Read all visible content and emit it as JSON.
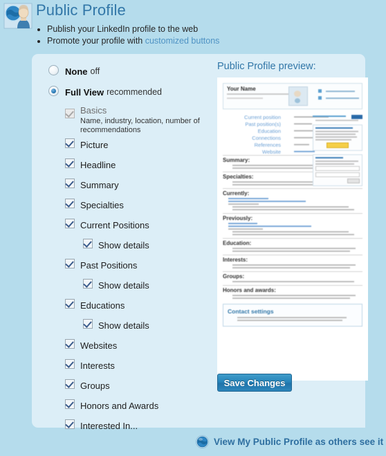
{
  "header": {
    "icon": "public-profile-avatar-icon",
    "title": "Public Profile",
    "bullets": [
      {
        "text_before": "Publish your LinkedIn profile to the web",
        "link": "",
        "text_after": ""
      },
      {
        "text_before": "Promote your profile with ",
        "link": "customized buttons",
        "text_after": ""
      }
    ]
  },
  "visibility": {
    "options": [
      {
        "label": "None",
        "sublabel": "off",
        "selected": false
      },
      {
        "label": "Full View",
        "sublabel": "recommended",
        "selected": true
      }
    ]
  },
  "sections": [
    {
      "label": "Basics",
      "checked": true,
      "disabled": true,
      "description": "Name, industry, location, number of recommendations",
      "sub": false
    },
    {
      "label": "Picture",
      "checked": true,
      "disabled": false,
      "description": "",
      "sub": false
    },
    {
      "label": "Headline",
      "checked": true,
      "disabled": false,
      "description": "",
      "sub": false
    },
    {
      "label": "Summary",
      "checked": true,
      "disabled": false,
      "description": "",
      "sub": false
    },
    {
      "label": "Specialties",
      "checked": true,
      "disabled": false,
      "description": "",
      "sub": false
    },
    {
      "label": "Current Positions",
      "checked": true,
      "disabled": false,
      "description": "",
      "sub": false
    },
    {
      "label": "Show details",
      "checked": true,
      "disabled": false,
      "description": "",
      "sub": true
    },
    {
      "label": "Past Positions",
      "checked": true,
      "disabled": false,
      "description": "",
      "sub": false
    },
    {
      "label": "Show details",
      "checked": true,
      "disabled": false,
      "description": "",
      "sub": true
    },
    {
      "label": "Educations",
      "checked": true,
      "disabled": false,
      "description": "",
      "sub": false
    },
    {
      "label": "Show details",
      "checked": true,
      "disabled": false,
      "description": "",
      "sub": true
    },
    {
      "label": "Websites",
      "checked": true,
      "disabled": false,
      "description": "",
      "sub": false
    },
    {
      "label": "Interests",
      "checked": true,
      "disabled": false,
      "description": "",
      "sub": false
    },
    {
      "label": "Groups",
      "checked": true,
      "disabled": false,
      "description": "",
      "sub": false
    },
    {
      "label": "Honors and Awards",
      "checked": true,
      "disabled": false,
      "description": "",
      "sub": false
    },
    {
      "label": "Interested In...",
      "checked": true,
      "disabled": false,
      "description": "",
      "sub": false
    }
  ],
  "preview": {
    "heading": "Public Profile preview:",
    "name": "Your Name",
    "field_labels": [
      "Current position",
      "Past position(s)",
      "Education",
      "Connections",
      "References",
      "Website"
    ],
    "body_sections": [
      "Summary:",
      "Specialties:",
      "Currently:",
      "Previously:",
      "Education:",
      "Interests:",
      "Groups:",
      "Honors and awards:"
    ],
    "contact_box_title": "Contact settings"
  },
  "actions": {
    "save_label": "Save Changes",
    "footer_link_label": "View My Public Profile as others see it",
    "footer_link_icon": "globe-icon"
  },
  "colors": {
    "page_background": "#b5dcec",
    "panel_background": "#dceef7",
    "heading_blue": "#3277a8",
    "link_blue": "#4f93c4",
    "button_blue": "#2785bb"
  }
}
